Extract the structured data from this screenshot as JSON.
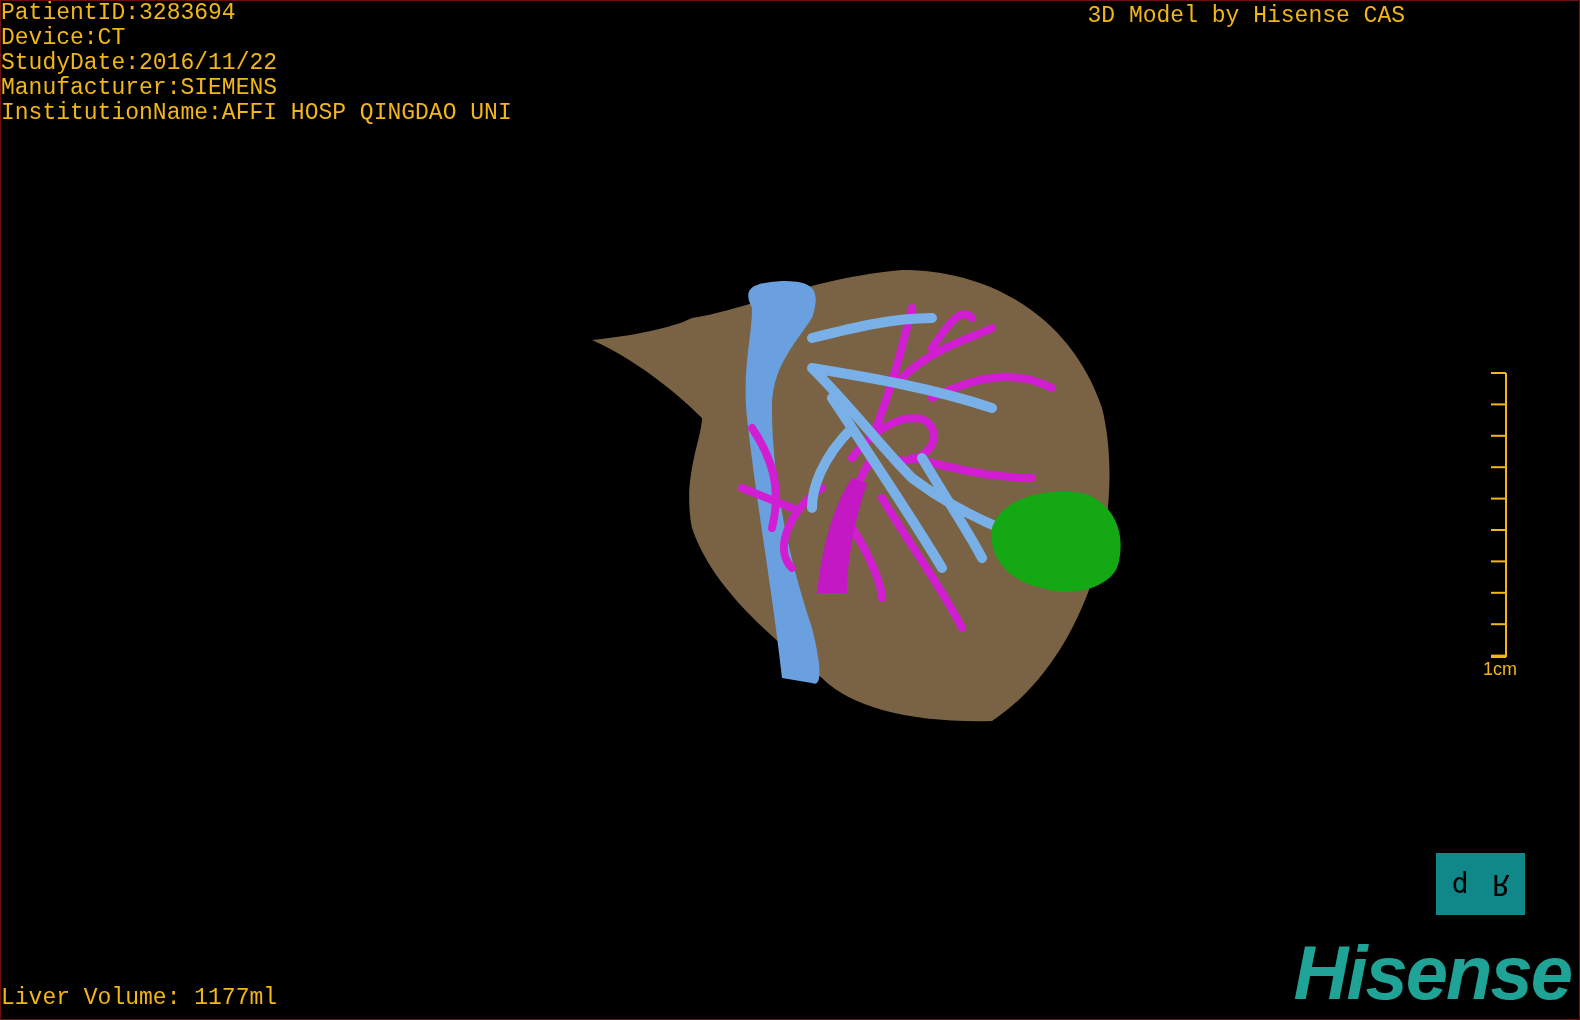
{
  "patient_info": [
    "PatientID:3283694",
    "Device:CT",
    "StudyDate:2016/11/22",
    "Manufacturer:SIEMENS",
    "InstitutionName:AFFI HOSP QINGDAO UNI"
  ],
  "credit": "3D Model by Hisense CAS",
  "scale_bar": {
    "label": "1cm"
  },
  "orientation_marker": {
    "labels": [
      "d",
      "R"
    ]
  },
  "logo": "Hisense",
  "liver_volume": "Liver Volume: 1177ml"
}
